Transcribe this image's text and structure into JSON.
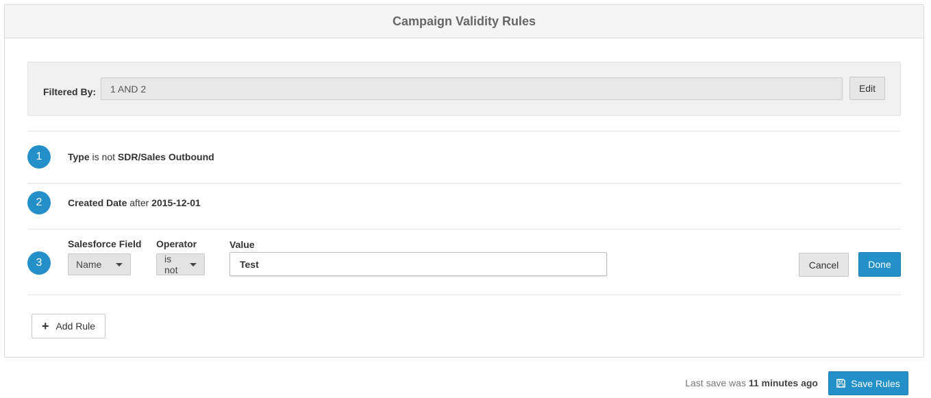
{
  "header": {
    "title": "Campaign Validity Rules"
  },
  "filter": {
    "label": "Filtered By:",
    "value": "1 AND 2",
    "edit_label": "Edit"
  },
  "rules": [
    {
      "number": "1",
      "field": "Type",
      "operator": "is not",
      "value": "SDR/Sales Outbound"
    },
    {
      "number": "2",
      "field": "Created Date",
      "operator": "after",
      "value": "2015-12-01"
    }
  ],
  "editing_rule": {
    "number": "3",
    "salesforce_field_label": "Salesforce Field",
    "salesforce_field_value": "Name",
    "operator_label": "Operator",
    "operator_value": "is not",
    "value_label": "Value",
    "value": "Test",
    "cancel_label": "Cancel",
    "done_label": "Done"
  },
  "add_rule": {
    "label": "Add Rule",
    "icon": "plus-icon"
  },
  "footer": {
    "last_save_prefix": "Last save was",
    "last_save_time": "11 minutes ago",
    "save_label": "Save Rules",
    "save_icon": "floppy-disk-icon"
  },
  "colors": {
    "accent": "#2490c9",
    "header_bg": "#f5f5f5"
  }
}
